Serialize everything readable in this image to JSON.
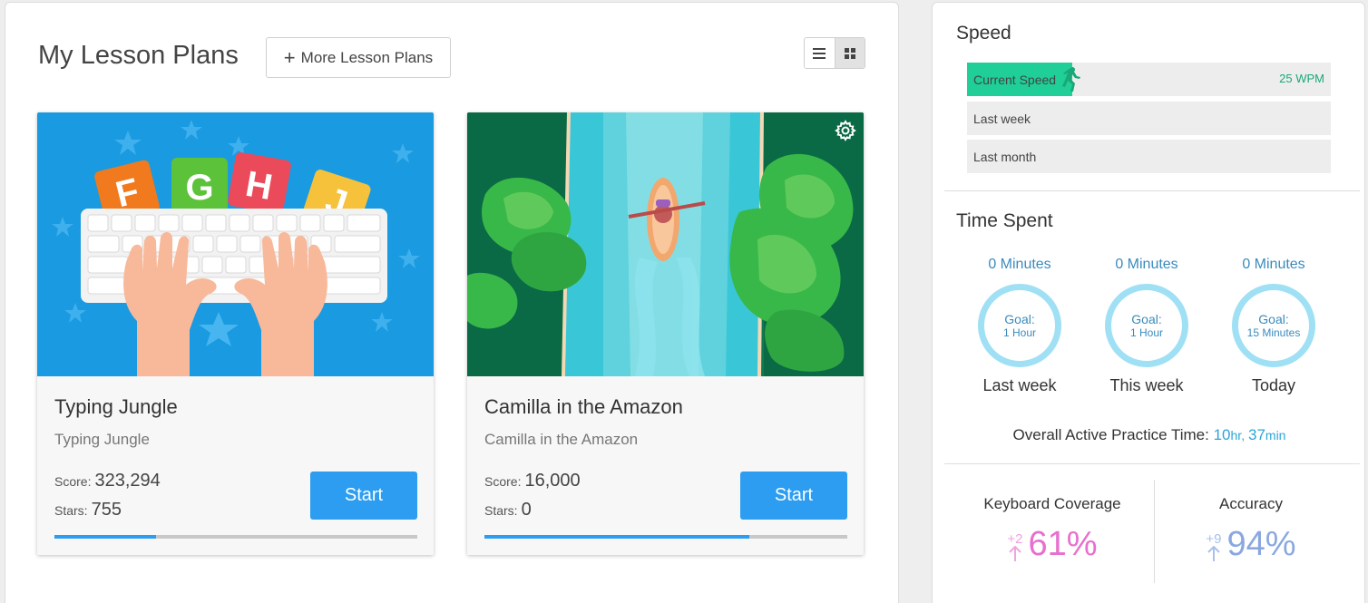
{
  "lessons": {
    "title": "My Lesson Plans",
    "more_button_label": "More Lesson Plans",
    "view_toggle": {
      "active": "grid"
    },
    "cards": [
      {
        "title": "Typing Jungle",
        "subtitle": "Typing Jungle",
        "score_label": "Score:",
        "score": "323,294",
        "stars_label": "Stars:",
        "stars": "755",
        "start_label": "Start",
        "progress": 0.28,
        "image_icon": "keyboard-letters-illustration",
        "thumb_letters": [
          "F",
          "G",
          "H",
          "J"
        ]
      },
      {
        "title": "Camilla in the Amazon",
        "subtitle": "Camilla in the Amazon",
        "score_label": "Score:",
        "score": "16,000",
        "stars_label": "Stars:",
        "stars": "0",
        "start_label": "Start",
        "progress": 0.73,
        "image_icon": "river-canoe-illustration",
        "settings_icon": "gear-icon"
      }
    ]
  },
  "stats": {
    "speed": {
      "title": "Speed",
      "bars": [
        {
          "label": "Current Speed",
          "value": "25 WPM",
          "fraction": 0.29,
          "color": "#1fcf97"
        },
        {
          "label": "Last week"
        },
        {
          "label": "Last month"
        }
      ]
    },
    "time_spent": {
      "title": "Time Spent",
      "columns": [
        {
          "minutes": "0 Minutes",
          "goal_label": "Goal:",
          "goal": "1 Hour",
          "period": "Last week"
        },
        {
          "minutes": "0 Minutes",
          "goal_label": "Goal:",
          "goal": "1 Hour",
          "period": "This week"
        },
        {
          "minutes": "0 Minutes",
          "goal_label": "Goal:",
          "goal": "15 Minutes",
          "period": "Today"
        }
      ],
      "overall_label": "Overall Active Practice Time:",
      "overall_hours": "10",
      "overall_hours_unit": "hr",
      "overall_mins": "37",
      "overall_mins_unit": "min",
      "ring_color": "#9fe0f5"
    },
    "keyboard_coverage": {
      "title": "Keyboard Coverage",
      "delta": "+2",
      "value": "61%",
      "color": "#e86fce"
    },
    "accuracy": {
      "title": "Accuracy",
      "delta": "+9",
      "value": "94%",
      "color": "#8aa8e0"
    }
  }
}
